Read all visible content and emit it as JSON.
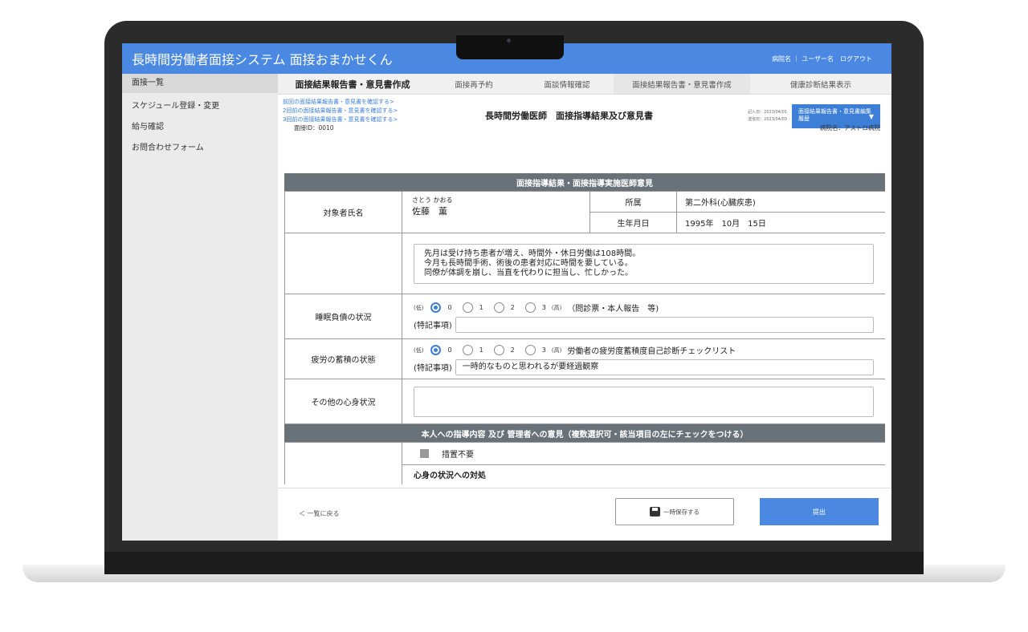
{
  "app": {
    "title": "長時間労働者面接システム 面接おまかせくん",
    "top_right": "病院名 ｜ ユーザー名　ログアウト"
  },
  "sidebar": {
    "items": [
      {
        "label": "面接一覧"
      },
      {
        "label": "スケジュール登録・変更"
      },
      {
        "label": "給与確認"
      },
      {
        "label": "お問合わせフォーム"
      }
    ]
  },
  "tabs": [
    {
      "label": "面接結果報告書・意見書作成"
    },
    {
      "label": "面接再予約"
    },
    {
      "label": "面談情報確認"
    },
    {
      "label": "面接結果報告書・意見書作成"
    },
    {
      "label": "健康診断結果表示"
    }
  ],
  "header": {
    "prev_links": [
      "前回の面接結果報告書・意見書を確認する>",
      "2回前の面接結果報告書・意見書を確認する>",
      "3回前の面接結果報告書・意見書を確認する>"
    ],
    "interview_id": "面接ID：0010",
    "doc_title": "長時間労働医師　面接指導結果及び意見書",
    "entry_date": "記入日：2023/04/01",
    "sent_date": "送信日：2023/04/03",
    "history_button": "面接結果報告書・意見書編集履歴",
    "hospital": "病院名：アストロ病院"
  },
  "form": {
    "section1_title": "面接指導結果・面接指導実施医師意見",
    "subject_label": "対象者氏名",
    "furigana": "さとう かおる",
    "name": "佐藤　薫",
    "dept_label": "所属",
    "dept_value": "第二外科(心臓疾患)",
    "dob_label": "生年月日",
    "dob_value": "1995年　10月　15日",
    "notes": [
      "先月は受け持ち患者が増え、時間外・休日労働は108時間。",
      "今月も長時間手術、術後の患者対応に時間を要している。",
      "同僚が体調を崩し、当直を代わりに担当し、忙しかった。"
    ],
    "low": "(低)",
    "high": "(高)",
    "special_label": "(特記事項)",
    "sleep": {
      "label": "睡眠負債の状況",
      "scale": [
        "0",
        "1",
        "2",
        "3"
      ],
      "selected": 0,
      "source": "（問診票・本人報告　等)",
      "special": ""
    },
    "fatigue": {
      "label": "疲労の蓄積の状態",
      "scale": [
        "0",
        "1",
        "2",
        "3"
      ],
      "selected": 0,
      "source": "労働者の疲労度蓄積度自己診断チェックリスト",
      "special": "一時的なものと思われるが要経過観察"
    },
    "other_label": "その他の心身状況",
    "section2_title": "本人への指導内容 及び 管理者への意見（複数選択可・該当項目の左にチェックをつける）",
    "no_measure": "措置不要",
    "mental_title": "心身の状況への対処"
  },
  "footer": {
    "back": "＜ 一覧に戻る",
    "save": "一時保存する",
    "submit": "提出"
  },
  "colors": {
    "accent": "#4a88e2",
    "section_header": "#687278"
  }
}
